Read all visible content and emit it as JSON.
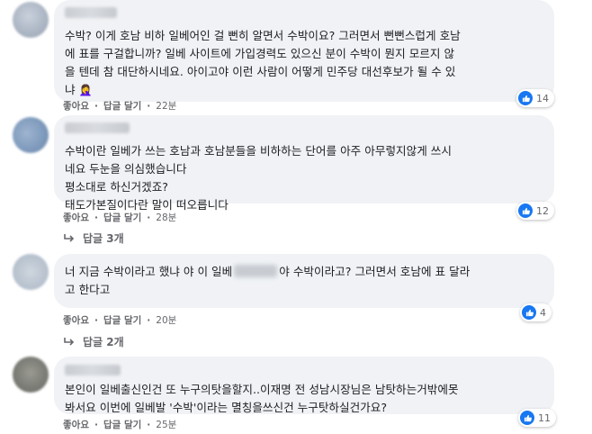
{
  "comments": [
    {
      "lines": [
        "수박? 이게 호남 비하 일베어인 걸 뻔히 알면서 수박이요? 그러면서 뻔뻔스럽게 호남",
        "에 표를 구걸합니까? 일베 사이트에 가입경력도 있으신 분이 수박이 뭔지 모르지 않",
        "을 텐데 참 대단하시네요. 아이고야 이런 사람이 어떻게 민주당 대선후보가 될 수 있",
        "냐"
      ],
      "emoji": "🤦‍♀️",
      "reaction_count": "14",
      "like": "좋아요",
      "reply": "답글 달기",
      "time": "22분"
    },
    {
      "lines": [
        "수박이란 일베가 쓰는 호남과 호남분들을 비하하는 단어를 아주 아무렇지않게 쓰시",
        "네요 두눈을 의심했습니다",
        "평소대로 하신거겠죠?",
        "태도가본질이다란 말이 떠오릅니다"
      ],
      "reaction_count": "12",
      "like": "좋아요",
      "reply": "답글 달기",
      "time": "28분",
      "replies_label": "답글 3개"
    },
    {
      "line1_before": "너 지금 수박이라고 했냐 야 이 일베",
      "line1_after": "야 수박이라고? 그러면서 호남에 표 달라",
      "line2": "고 한다고",
      "reaction_count": "4",
      "like": "좋아요",
      "reply": "답글 달기",
      "time": "20분",
      "replies_label": "답글 2개"
    },
    {
      "lines": [
        "본인이 일베출신인건 또 누구의탓을할지..이재명 전 성남시장님은 남탓하는거밖에못",
        "봐서요 이번에 일베발 '수박'이라는 멸칭을쓰신건 누구탓하실건가요?"
      ],
      "reaction_count": "11",
      "like": "좋아요",
      "reply": "답글 달기",
      "time": "25분"
    }
  ],
  "separator": "·",
  "icons": {
    "like": "thumbs-up-icon",
    "reply_arrow": "reply-arrow-icon"
  },
  "colors": {
    "like_blue": "#1877f2",
    "bubble_bg": "#f0f2f5",
    "meta_text": "#65676b"
  }
}
